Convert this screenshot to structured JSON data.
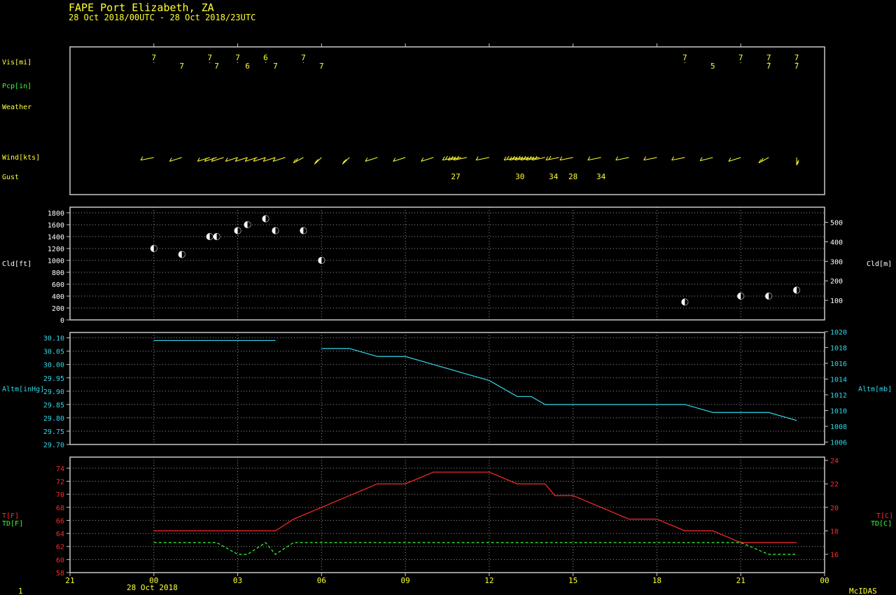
{
  "header": {
    "title": "FAPE  Port Elizabeth,  ZA",
    "subtitle": "28 Oct 2018/00UTC - 28 Oct 2018/23UTC"
  },
  "footer": {
    "left_label": "1",
    "date_label": "28 Oct 2018",
    "brand": "McIDAS"
  },
  "colors": {
    "background": "#000000",
    "frame": "#c8c8c8",
    "grid": "#9a9a9a",
    "yellow": "#ffff33",
    "green": "#33ff33",
    "cyan": "#33d6e6",
    "red": "#ff2a2a",
    "white": "#ffffff"
  },
  "time_axis": {
    "range_hours": [
      -3,
      24
    ],
    "tick_hours": [
      -3,
      0,
      3,
      6,
      9,
      12,
      15,
      18,
      21,
      24
    ],
    "tick_labels": [
      "21",
      "00",
      "03",
      "06",
      "09",
      "12",
      "15",
      "18",
      "21",
      "00"
    ]
  },
  "chart_data": [
    {
      "type": "table",
      "panel": "observations",
      "row_labels": {
        "vis": "Vis[mi]",
        "pcp": "Pcp[in]",
        "weather": "Weather",
        "wind": "Wind[kts]",
        "gust": "Gust"
      },
      "visibility": {
        "unit": "mi",
        "points": [
          {
            "hour": 0.0,
            "value": "7",
            "row": 0
          },
          {
            "hour": 1.0,
            "value": "7",
            "row": 1
          },
          {
            "hour": 2.0,
            "value": "7",
            "row": 0
          },
          {
            "hour": 2.25,
            "value": "7",
            "row": 1
          },
          {
            "hour": 3.0,
            "value": "7",
            "row": 0
          },
          {
            "hour": 3.35,
            "value": "6",
            "row": 1
          },
          {
            "hour": 4.0,
            "value": "6",
            "row": 0
          },
          {
            "hour": 4.35,
            "value": "7",
            "row": 1
          },
          {
            "hour": 5.35,
            "value": "7",
            "row": 0
          },
          {
            "hour": 6.0,
            "value": "7",
            "row": 1
          },
          {
            "hour": 19.0,
            "value": "7",
            "row": 0
          },
          {
            "hour": 20.0,
            "value": "5",
            "row": 1
          },
          {
            "hour": 21.0,
            "value": "7",
            "row": 0
          },
          {
            "hour": 22.0,
            "value": "7",
            "row": 0
          },
          {
            "hour": 22.0,
            "value": "7",
            "row": 1
          },
          {
            "hour": 23.0,
            "value": "7",
            "row": 0
          },
          {
            "hour": 23.0,
            "value": "7",
            "row": 1
          }
        ]
      },
      "wind": {
        "unit": "kts",
        "hours": [
          0,
          1,
          2,
          2.25,
          2.5,
          3,
          3.35,
          3.7,
          4,
          4.35,
          4.7,
          5.35,
          6,
          7,
          8,
          9,
          10,
          10.8,
          11,
          11.2,
          12,
          13,
          13.2,
          13.4,
          13.6,
          13.8,
          14,
          14.5,
          15,
          16,
          17,
          18,
          19,
          20,
          21,
          22,
          23
        ],
        "direction_deg": [
          250,
          240,
          240,
          240,
          240,
          240,
          240,
          240,
          240,
          240,
          240,
          225,
          210,
          210,
          240,
          240,
          240,
          250,
          250,
          250,
          250,
          250,
          250,
          250,
          250,
          250,
          250,
          250,
          250,
          250,
          250,
          250,
          250,
          245,
          240,
          225,
          180
        ],
        "speed_kts": [
          12,
          12,
          12,
          12,
          12,
          12,
          12,
          12,
          12,
          12,
          12,
          15,
          16,
          16,
          14,
          13,
          13,
          15,
          15,
          15,
          14,
          16,
          16,
          16,
          16,
          16,
          16,
          16,
          14,
          13,
          13,
          13,
          13,
          13,
          14,
          18,
          18
        ]
      },
      "gust": {
        "unit": "kts",
        "points": [
          {
            "hour": 10.8,
            "value": "27"
          },
          {
            "hour": 13.1,
            "value": "30"
          },
          {
            "hour": 14.3,
            "value": "34"
          },
          {
            "hour": 15.0,
            "value": "28"
          },
          {
            "hour": 16.0,
            "value": "34"
          }
        ]
      }
    },
    {
      "type": "scatter",
      "panel": "cloud",
      "ylabel": "Cld[ft]",
      "y2label": "Cld[m]",
      "ylim": [
        0,
        1800
      ],
      "yticks": [
        0,
        200,
        400,
        600,
        800,
        1000,
        1200,
        1400,
        1600,
        1800
      ],
      "y2lim": [
        0,
        548.64
      ],
      "y2ticks": [
        100,
        200,
        300,
        400,
        500
      ],
      "grid": true,
      "points": [
        {
          "hour": 0.0,
          "ft": 1200
        },
        {
          "hour": 1.0,
          "ft": 1100
        },
        {
          "hour": 2.0,
          "ft": 1400
        },
        {
          "hour": 2.25,
          "ft": 1400
        },
        {
          "hour": 3.0,
          "ft": 1500
        },
        {
          "hour": 3.35,
          "ft": 1600
        },
        {
          "hour": 4.0,
          "ft": 1700
        },
        {
          "hour": 4.35,
          "ft": 1500
        },
        {
          "hour": 5.35,
          "ft": 1500
        },
        {
          "hour": 6.0,
          "ft": 1000
        },
        {
          "hour": 19.0,
          "ft": 300
        },
        {
          "hour": 21.0,
          "ft": 400
        },
        {
          "hour": 22.0,
          "ft": 400
        },
        {
          "hour": 23.0,
          "ft": 500
        }
      ]
    },
    {
      "type": "line",
      "panel": "altimeter",
      "ylabel": "Altm[inHg]",
      "y2label": "Altm[mb]",
      "ylim": [
        29.7,
        30.12
      ],
      "yticks": [
        29.7,
        29.75,
        29.8,
        29.85,
        29.9,
        29.95,
        30.0,
        30.05,
        30.1
      ],
      "ytick_labels": [
        "29.70",
        "29.75",
        "29.80",
        "29.85",
        "29.90",
        "29.95",
        "30.00",
        "30.05",
        "30.10"
      ],
      "y2lim": [
        1005.7,
        1019.9
      ],
      "y2ticks": [
        1006,
        1008,
        1010,
        1012,
        1014,
        1016,
        1018,
        1020
      ],
      "grid": true,
      "segments": [
        {
          "hours": [
            0,
            4.35
          ],
          "values": [
            30.09,
            30.09
          ]
        },
        {
          "hours": [
            6,
            7,
            8,
            9,
            10,
            11,
            12,
            13,
            13.5,
            14,
            15,
            16,
            17,
            18,
            19,
            20,
            21,
            22,
            23
          ],
          "values": [
            30.06,
            30.06,
            30.03,
            30.03,
            30.0,
            29.97,
            29.94,
            29.88,
            29.88,
            29.85,
            29.85,
            29.85,
            29.85,
            29.85,
            29.85,
            29.82,
            29.82,
            29.82,
            29.79
          ]
        }
      ]
    },
    {
      "type": "line",
      "panel": "temperature",
      "ylabel": "T[F]",
      "ylabel2": "TD[F]",
      "y2label": "T[C]",
      "y2label2": "TD[C]",
      "ylim": [
        58,
        75.7
      ],
      "yticks": [
        58,
        60,
        62,
        64,
        66,
        68,
        70,
        72,
        74
      ],
      "y2ticks": [
        16,
        18,
        20,
        22,
        24
      ],
      "grid": true,
      "series": [
        {
          "name": "T",
          "hours": [
            0,
            1,
            2,
            3,
            4,
            4.35,
            5,
            6,
            7,
            8,
            9,
            10,
            11,
            12,
            13,
            14,
            14.35,
            15,
            16,
            17,
            18,
            19,
            20,
            21,
            22,
            23
          ],
          "values": [
            64.4,
            64.4,
            64.4,
            64.4,
            64.4,
            64.4,
            66.2,
            68.0,
            69.8,
            71.6,
            71.6,
            73.4,
            73.4,
            73.4,
            71.6,
            71.6,
            69.8,
            69.8,
            68.0,
            66.2,
            66.2,
            64.4,
            64.4,
            62.6,
            62.6,
            62.6
          ]
        },
        {
          "name": "TD",
          "hours": [
            0,
            1,
            2,
            2.25,
            3,
            3.35,
            4,
            4.35,
            5,
            5.35,
            6,
            7,
            8,
            9,
            10,
            11,
            12,
            13,
            14,
            15,
            16,
            17,
            18,
            19,
            20,
            21,
            22,
            23
          ],
          "values": [
            62.6,
            62.6,
            62.6,
            62.6,
            60.8,
            60.8,
            62.6,
            60.8,
            62.6,
            62.6,
            62.6,
            62.6,
            62.6,
            62.6,
            62.6,
            62.6,
            62.6,
            62.6,
            62.6,
            62.6,
            62.6,
            62.6,
            62.6,
            62.6,
            62.6,
            62.6,
            60.8,
            60.8
          ]
        }
      ]
    }
  ]
}
